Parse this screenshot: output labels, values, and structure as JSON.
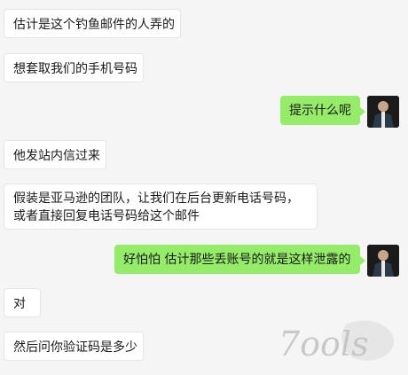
{
  "messages": [
    {
      "side": "left",
      "text": "估计是这个钓鱼邮件的人弄的"
    },
    {
      "side": "left",
      "text": "想套取我们的手机号码"
    },
    {
      "side": "right",
      "text": "提示什么呢"
    },
    {
      "side": "left",
      "text": "他发站内信过来"
    },
    {
      "side": "left",
      "text": "假装是亚马逊的团队，让我们在后台更新电话号码，或者直接回复电话号码给这个邮件"
    },
    {
      "side": "right",
      "text": "好怕怕 估计那些丢账号的就是这样泄露的"
    },
    {
      "side": "left",
      "text": "对"
    },
    {
      "side": "left",
      "text": "然后问你验证码是多少"
    }
  ],
  "watermark": {
    "text": "7ools"
  },
  "colors": {
    "background": "#f5f5f5",
    "incoming": "#ffffff",
    "outgoing": "#95ec69"
  }
}
